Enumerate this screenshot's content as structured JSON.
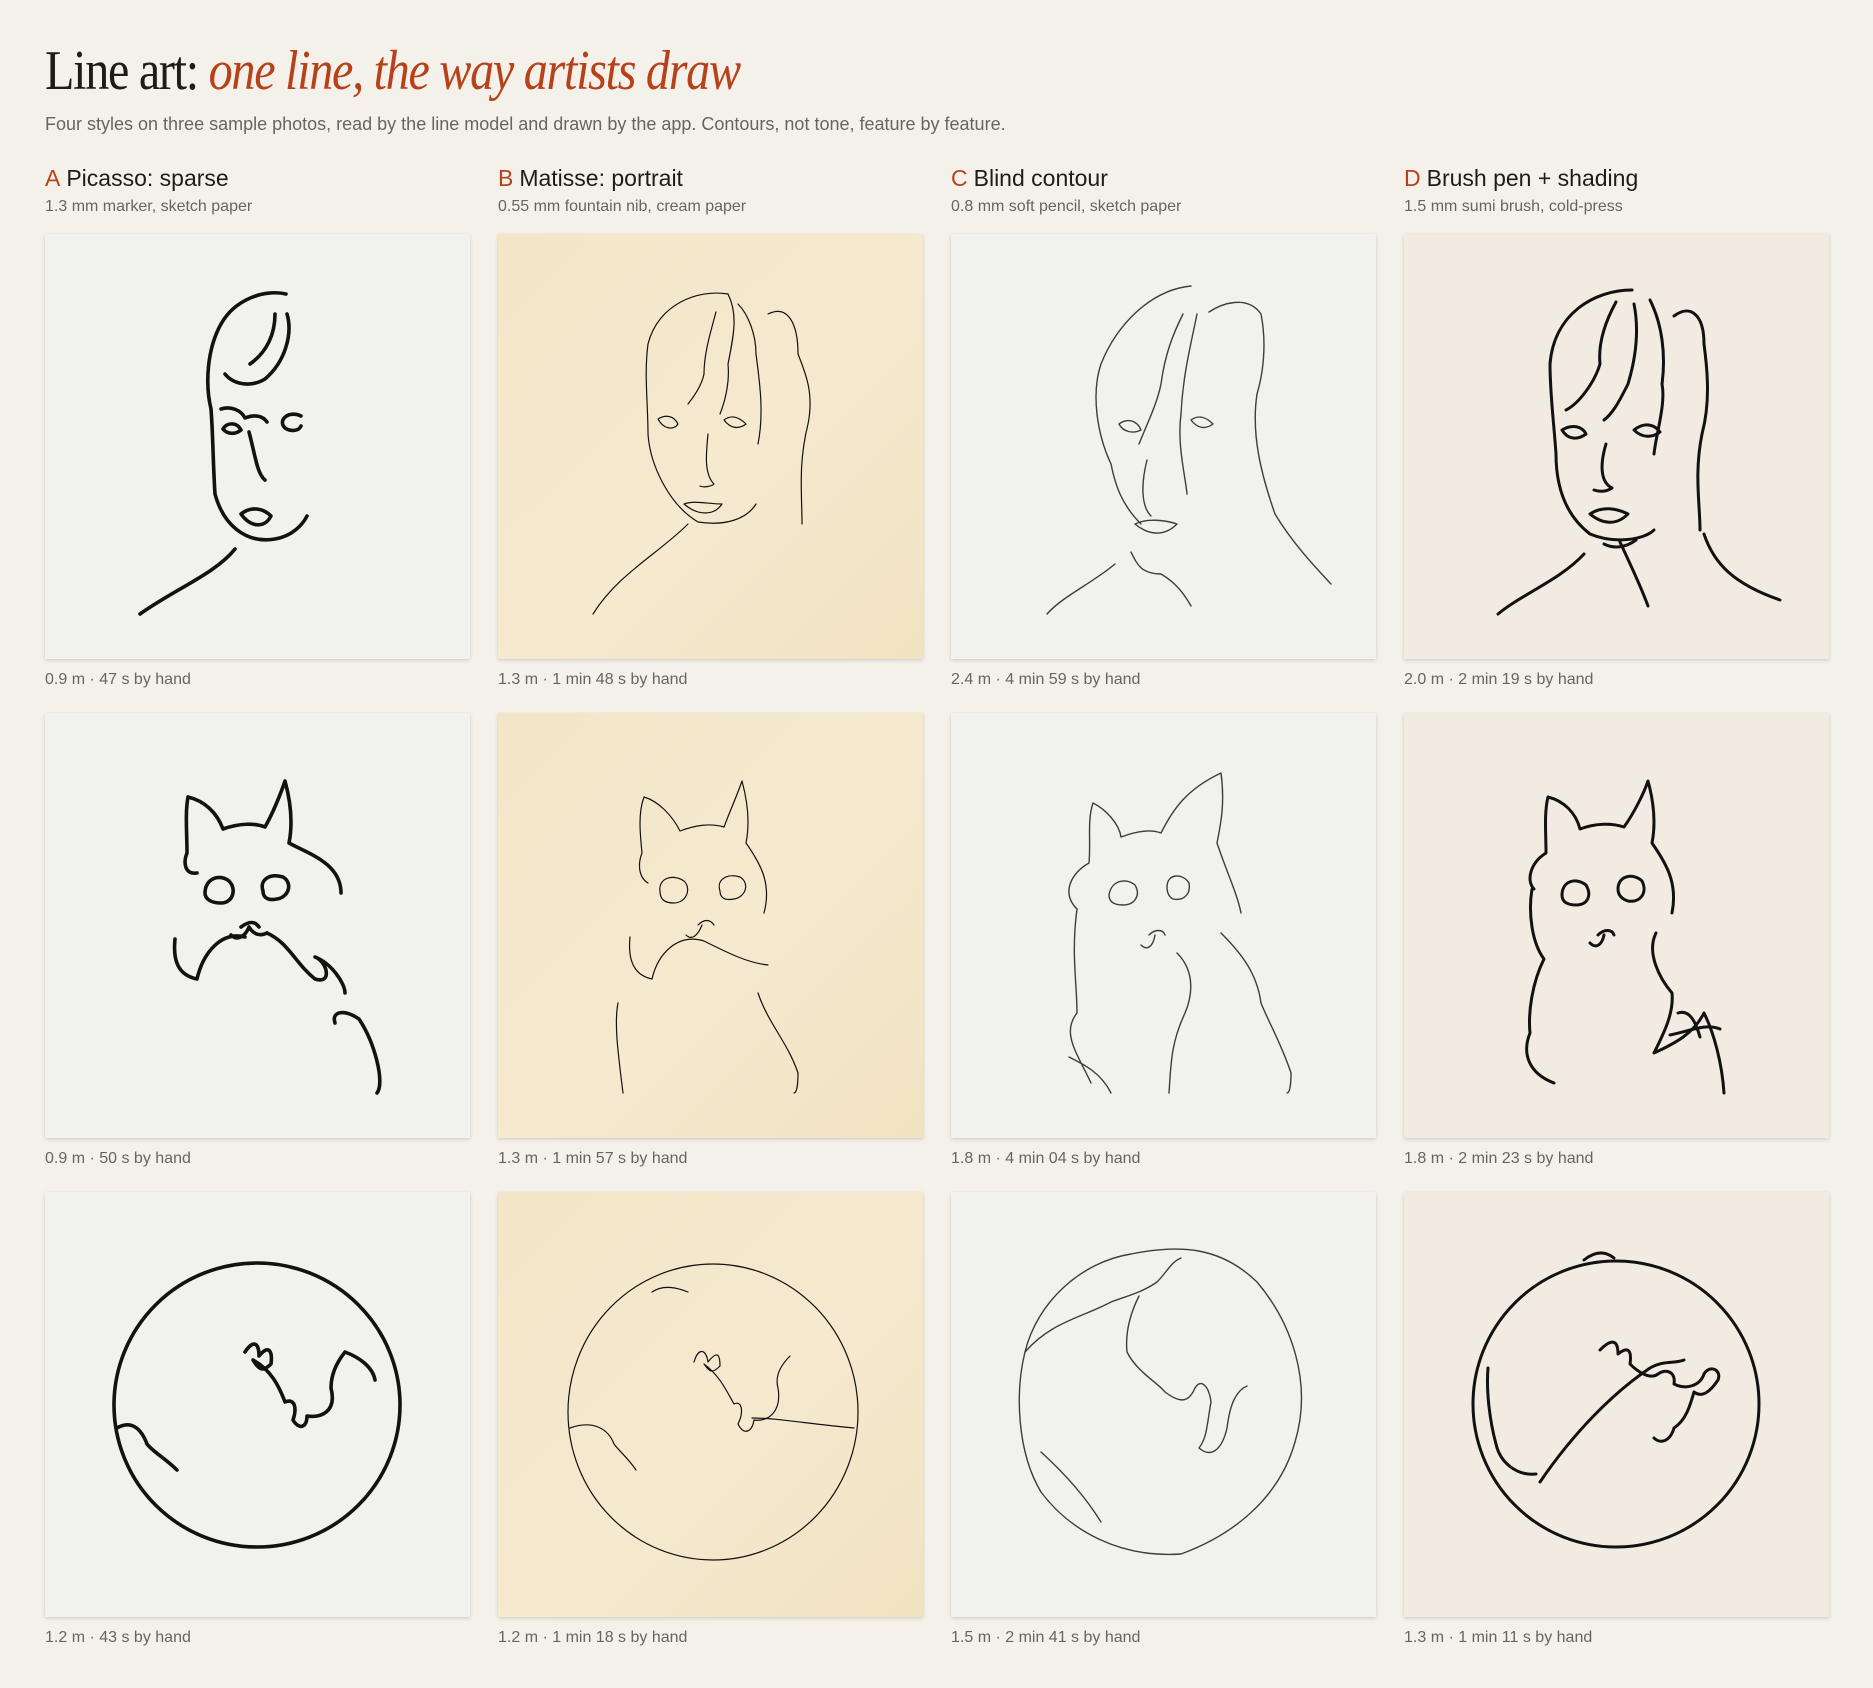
{
  "header": {
    "title_plain": "Line art:",
    "title_accent": "one line, the way artists draw",
    "subtitle": "Four styles on three sample photos, read by the line model and drawn by the app. Contours, not tone, feature by feature."
  },
  "colors": {
    "accent": "#b8411a",
    "background": "#f4f1eb",
    "ink": "#121212",
    "muted_text": "#6b645b"
  },
  "styles": [
    {
      "letter": "A",
      "name": "Picasso: sparse",
      "materials": "1.3 mm marker, sketch paper",
      "cells": [
        {
          "subject": "portrait",
          "caption": "0.9 m · 47 s by hand"
        },
        {
          "subject": "cat",
          "caption": "0.9 m · 50 s by hand"
        },
        {
          "subject": "globe",
          "caption": "1.2 m · 43 s by hand"
        }
      ]
    },
    {
      "letter": "B",
      "name": "Matisse: portrait",
      "materials": "0.55 mm fountain nib, cream paper",
      "cells": [
        {
          "subject": "portrait",
          "caption": "1.3 m · 1 min 48 s by hand"
        },
        {
          "subject": "cat",
          "caption": "1.3 m · 1 min 57 s by hand"
        },
        {
          "subject": "globe",
          "caption": "1.2 m · 1 min 18 s by hand"
        }
      ]
    },
    {
      "letter": "C",
      "name": "Blind contour",
      "materials": "0.8 mm soft pencil, sketch paper",
      "cells": [
        {
          "subject": "portrait",
          "caption": "2.4 m · 4 min 59 s by hand"
        },
        {
          "subject": "cat",
          "caption": "1.8 m · 4 min 04 s by hand"
        },
        {
          "subject": "globe",
          "caption": "1.5 m · 2 min 41 s by hand"
        }
      ]
    },
    {
      "letter": "D",
      "name": "Brush pen + shading",
      "materials": "1.5 mm sumi brush, cold-press",
      "cells": [
        {
          "subject": "portrait",
          "caption": "2.0 m · 2 min 19 s by hand"
        },
        {
          "subject": "cat",
          "caption": "1.8 m · 2 min 23 s by hand"
        },
        {
          "subject": "globe",
          "caption": "1.3 m · 1 min 11 s by hand"
        }
      ]
    }
  ]
}
